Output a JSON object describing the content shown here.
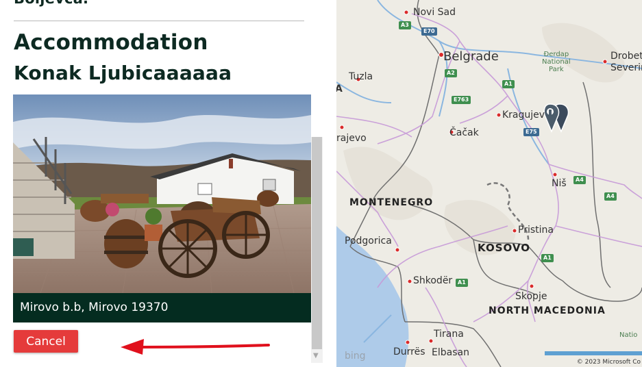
{
  "panel": {
    "cut_text": "Boljevca.",
    "section_heading": "Accommodation",
    "accommodation_name": "Konak Ljubicaaaaaa",
    "address": "Mirovo b.b, Mirovo 19370",
    "cancel_label": "Cancel"
  },
  "map": {
    "cities": {
      "novi_sad": "Novi Sad",
      "belgrade": "Belgrade",
      "tuzla": "Tuzla",
      "kragujevac": "Kragujev",
      "cacak": "Čačak",
      "sarajevo": "rajevo",
      "nis": "Niš",
      "podgorica": "Podgorica",
      "pristina": "Pristina",
      "shkoder": "Shkodër",
      "skopje": "Skopje",
      "tirana": "Tirana",
      "durres": "Durrës",
      "elbasan": "Elbasan",
      "drobeta": "Drobeta",
      "severin": "Severin",
      "a_cut": "A",
      "natio": "Natio"
    },
    "countries": {
      "montenegro": "MONTENEGRO",
      "kosovo": "KOSOVO",
      "north_macedonia": "NORTH MACEDONIA"
    },
    "park": [
      "Đerdap",
      "National",
      "Park"
    ],
    "shields": {
      "a3": "A3",
      "e70": "E70",
      "a2": "A2",
      "a1": "A1",
      "e763": "E763",
      "e75": "E75",
      "a4": "A4",
      "a4b": "A4",
      "a1b": "A1",
      "a1c": "A1"
    },
    "bing": "bing",
    "copyright": "© 2023 Microsoft Co"
  }
}
